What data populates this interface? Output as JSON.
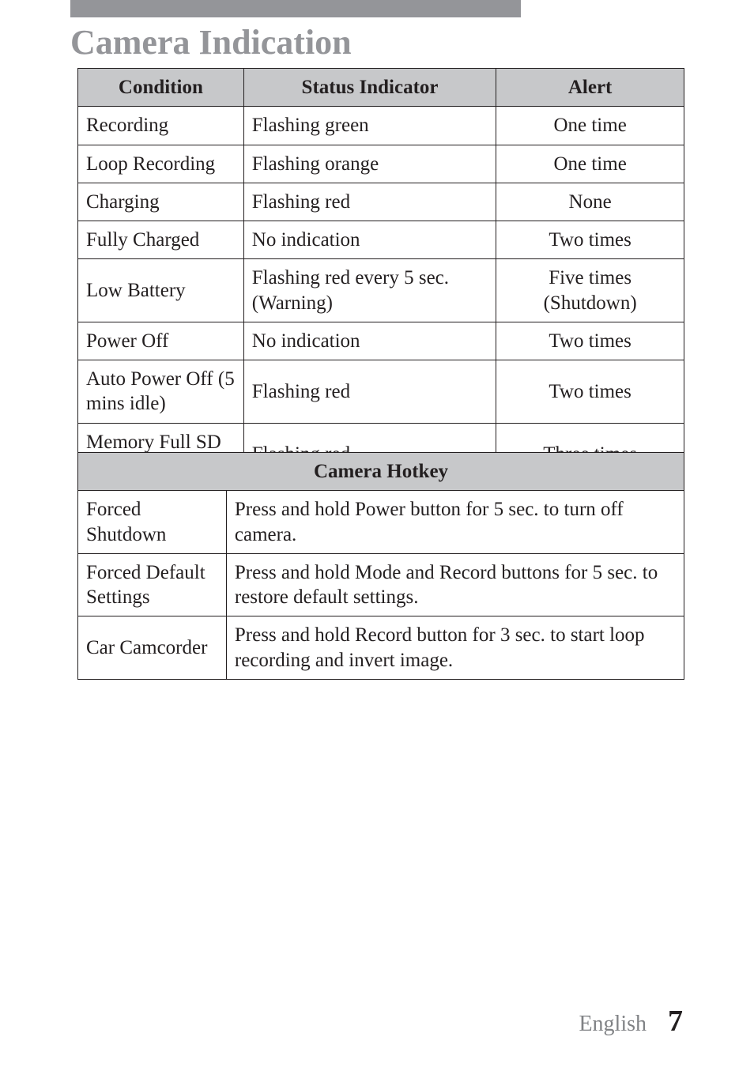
{
  "title": "Camera Indication",
  "table1": {
    "headers": [
      "Condition",
      "Status Indicator",
      "Alert"
    ],
    "rows": [
      [
        "Recording",
        "Flashing green",
        "One time"
      ],
      [
        "Loop Recording",
        "Flashing orange",
        "One time"
      ],
      [
        "Charging",
        "Flashing red",
        "None"
      ],
      [
        "Fully Charged",
        "No indication",
        "Two times"
      ],
      [
        "Low Battery",
        "Flashing red every 5 sec. (Warning)",
        "Five times (Shutdown)"
      ],
      [
        "Power Off",
        "No indication",
        "Two times"
      ],
      [
        "Auto Power Off (5 mins idle)",
        "Flashing red",
        "Two times"
      ],
      [
        "Memory Full SD Card Error",
        "Flashing red",
        "Three times"
      ]
    ]
  },
  "table2": {
    "header": "Camera Hotkey",
    "rows": [
      [
        "Forced Shutdown",
        "Press and hold Power button for 5 sec. to turn off camera."
      ],
      [
        "Forced Default Settings",
        "Press and hold Mode and Record buttons for 5 sec. to restore default settings."
      ],
      [
        "Car Camcorder",
        "Press and hold Record button for 3 sec. to start loop recording and invert image."
      ]
    ]
  },
  "footer": {
    "language": "English",
    "page": "7"
  }
}
